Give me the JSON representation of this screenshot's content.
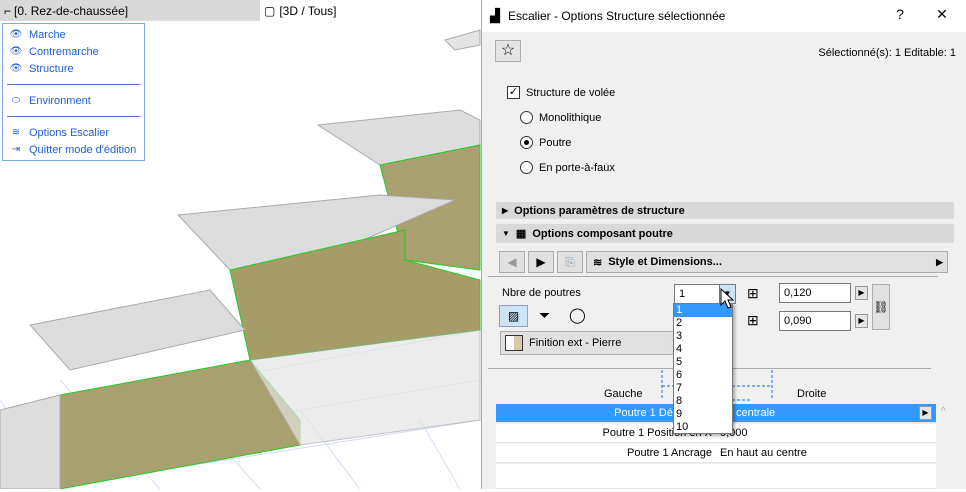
{
  "viewport": {
    "tab_floor": "[0. Rez-de-chaussée]",
    "tab_3d": "[3D / Tous]"
  },
  "context_menu": {
    "items": [
      {
        "label": "Marche",
        "icon": "eye-icon"
      },
      {
        "label": "Contremarche",
        "icon": "eye-icon"
      },
      {
        "label": "Structure",
        "icon": "eye-icon"
      },
      {
        "label": "Environment",
        "icon": "eye-closed-icon"
      },
      {
        "label": "Options Escalier",
        "icon": "stair-settings-icon"
      },
      {
        "label": "Quitter mode d'édition",
        "icon": "exit-icon"
      }
    ]
  },
  "dialog": {
    "title": "Escalier - Options Structure sélectionnée",
    "help": "?",
    "close": "✕",
    "selected_info": "Sélectionné(s): 1 Editable: 1",
    "structure_label": "Structure de volée",
    "structure_checked": true,
    "radios": [
      {
        "label": "Monolithique",
        "checked": false
      },
      {
        "label": "Poutre",
        "checked": true
      },
      {
        "label": "En porte-à-faux",
        "checked": false
      }
    ],
    "section1": "Options paramètres de structure",
    "section2": "Options composant poutre",
    "style_button": "Style et Dimensions...",
    "beam_count_label": "Nbre de poutres",
    "beam_count_value": "1",
    "beam_count_options": [
      "1",
      "2",
      "3",
      "4",
      "5",
      "6",
      "7",
      "8",
      "9",
      "10"
    ],
    "width_value": "0,120",
    "height_value": "0,090",
    "finish": "Finition ext - Pierre",
    "left_label": "Gauche",
    "right_label": "Droite",
    "properties": [
      {
        "name": "Poutre 1 Décaler de",
        "value": "centrale"
      },
      {
        "name": "Poutre 1 Position en X",
        "value": "0,000"
      },
      {
        "name": "Poutre 1 Ancrage",
        "value": "En haut au centre"
      }
    ],
    "accent": "#3399ff"
  }
}
